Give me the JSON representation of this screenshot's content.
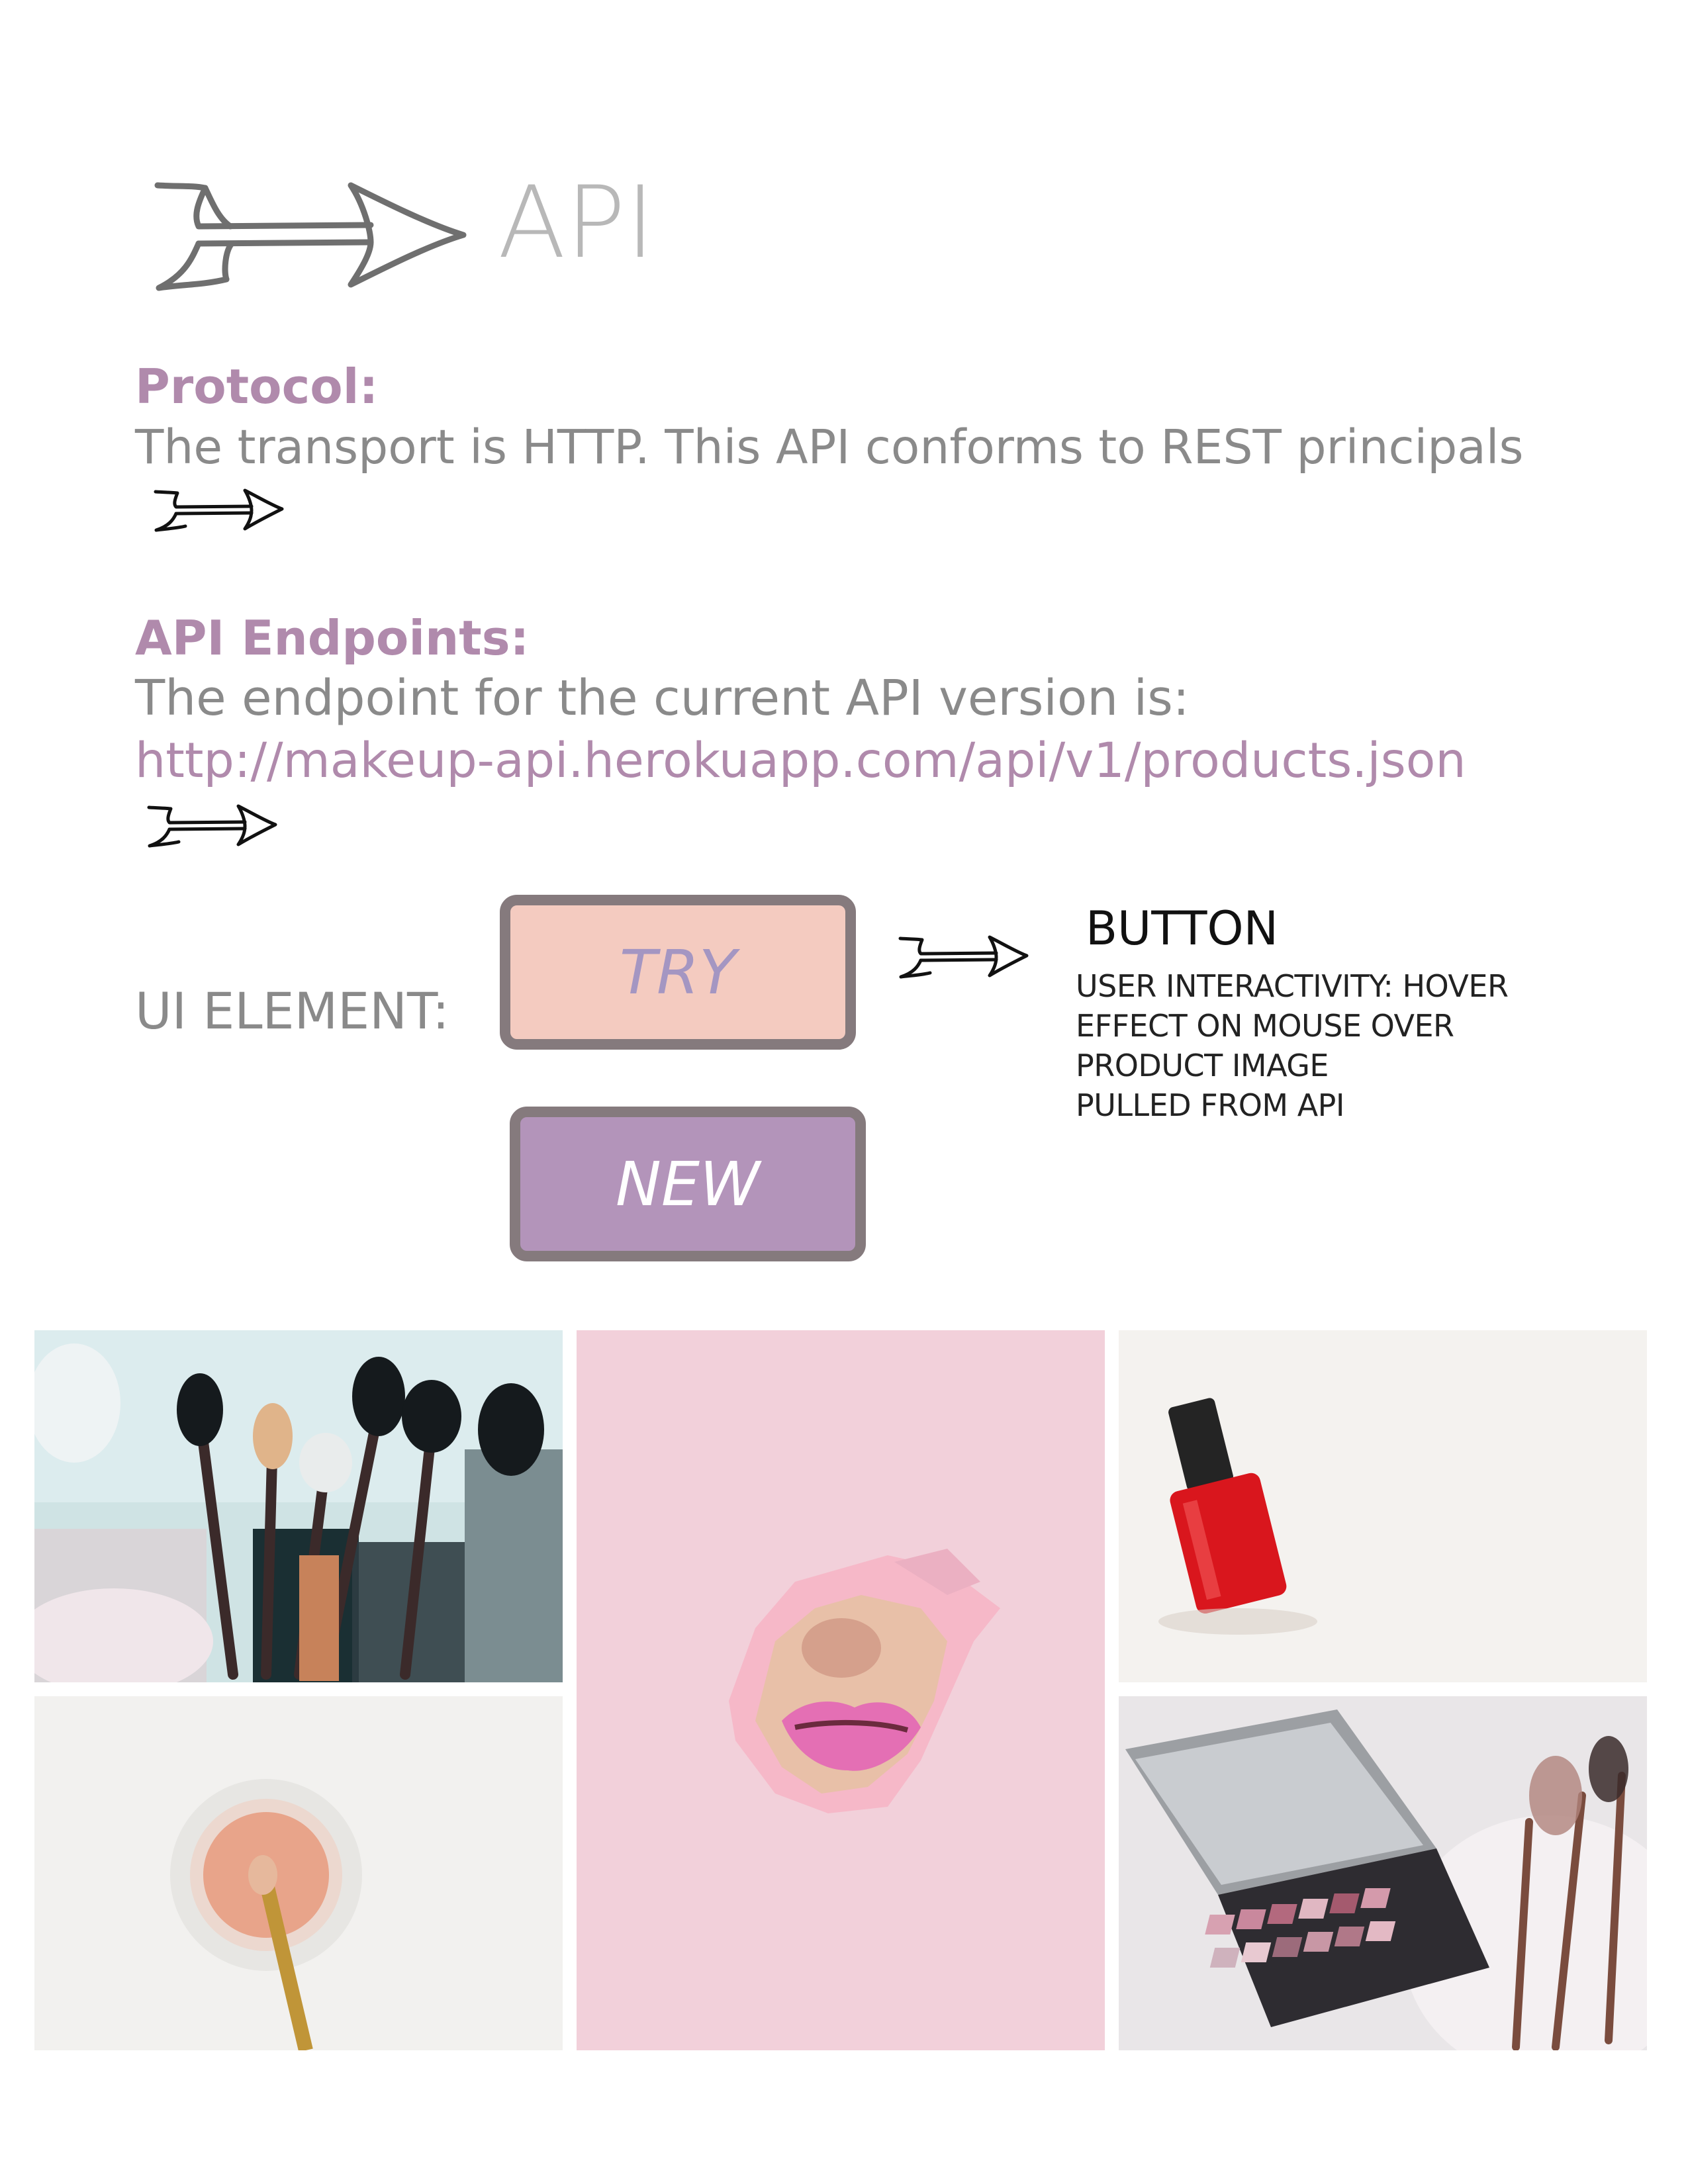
{
  "header": {
    "title": "API",
    "arrow_icon": "hand-drawn-arrow-icon"
  },
  "protocol": {
    "heading": "Protocol:",
    "text": "The transport is HTTP. This API conforms to REST principals"
  },
  "endpoints": {
    "heading": "API Endpoints:",
    "text": "The endpoint for the current API version is:",
    "url": "http://makeup-api.herokuapp.com/api/v1/products.json"
  },
  "ui_element": {
    "label": "UI ELEMENT:",
    "try_button": "TRY",
    "new_button": "NEW",
    "note_title": "BUTTON",
    "note_lines": [
      "USER INTERACTIVITY: HOVER",
      "EFFECT ON MOUSE OVER",
      "PRODUCT IMAGE",
      "PULLED FROM API"
    ]
  },
  "colors": {
    "heading": "#b08aac",
    "body_text": "#8a8a8a",
    "title": "#b8b8b8",
    "try_fill": "#f4cbc0",
    "try_text": "#a496c2",
    "new_fill": "#b394ba",
    "new_text": "#ffffff",
    "button_border": "#857a7d"
  },
  "gallery": [
    {
      "subject": "makeup-brushes-photo"
    },
    {
      "subject": "lips-through-paper-photo"
    },
    {
      "subject": "red-nail-polish-photo"
    },
    {
      "subject": "loose-powder-brush-photo"
    },
    {
      "subject": "eyeshadow-palette-photo"
    }
  ]
}
